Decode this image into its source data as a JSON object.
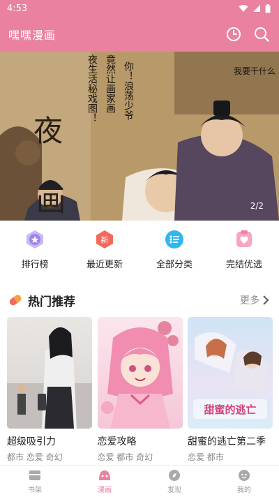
{
  "status_bar": {
    "time": "4:53"
  },
  "app_bar": {
    "title": "嘿嘿漫画",
    "history_icon": "clock-icon",
    "search_icon": "search-icon"
  },
  "banner": {
    "counter": "2/2",
    "title_art": "夜画",
    "caption_line1": "你！浪荡少爷",
    "caption_line2": "竟然让画家画",
    "caption_line3": "夜生活秘戏图！",
    "corner_text": "我要干什么"
  },
  "quick_nav": [
    {
      "label": "排行榜",
      "icon": "ranking-medal-icon",
      "color": "#a98be8"
    },
    {
      "label": "最近更新",
      "icon": "new-badge-icon",
      "color": "#f06a5e"
    },
    {
      "label": "全部分类",
      "icon": "category-list-icon",
      "color": "#31b7f0"
    },
    {
      "label": "完结优选",
      "icon": "finished-heart-icon",
      "color": "#f27fa6"
    }
  ],
  "section": {
    "title": "热门推荐",
    "more": "更多",
    "title_icon": "hot-pill-icon"
  },
  "comics": [
    {
      "title": "超级吸引力",
      "tags": "都市 恋爱 奇幻"
    },
    {
      "title": "恋爱攻略",
      "tags": "恋爱 都市 奇幻"
    },
    {
      "title": "甜蜜的逃亡第二季",
      "tags": "恋爱 都市",
      "cover_text": "甜蜜的逃亡"
    }
  ],
  "bottom_nav": [
    {
      "label": "书架",
      "icon": "bookshelf-icon"
    },
    {
      "label": "漫画",
      "icon": "comic-icon",
      "active": true
    },
    {
      "label": "发现",
      "icon": "discover-icon"
    },
    {
      "label": "我的",
      "icon": "profile-icon"
    }
  ],
  "colors": {
    "accent": "#e9819f"
  }
}
